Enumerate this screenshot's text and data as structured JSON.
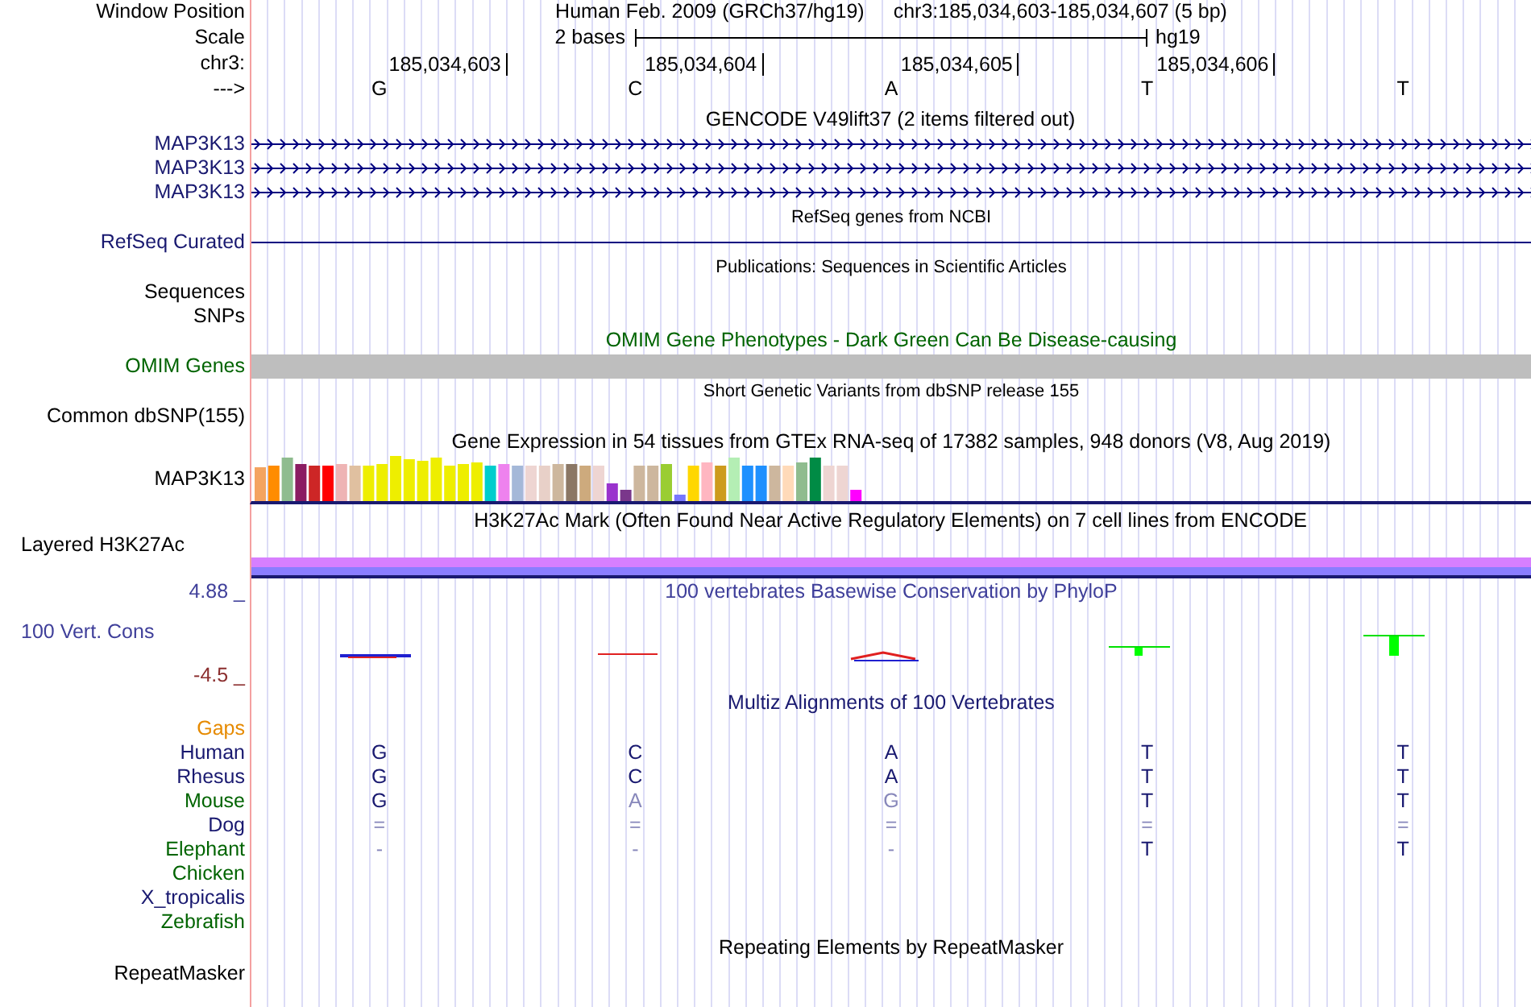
{
  "header": {
    "window_position_label": "Window Position",
    "assembly": "Human Feb. 2009 (GRCh37/hg19)",
    "position": "chr3:185,034,603-185,034,607 (5 bp)",
    "scale_label": "Scale",
    "scale_text": "2 bases",
    "scale_db": "hg19",
    "chrom_label": "chr3:",
    "ticks": [
      "185,034,603",
      "185,034,604",
      "185,034,605",
      "185,034,606"
    ],
    "strand_label": "--->",
    "bases": [
      "G",
      "C",
      "A",
      "T",
      "T"
    ]
  },
  "tracks": [
    {
      "kind": "gene",
      "title": "GENCODE V49lift37 (2 items filtered out)",
      "small_title": false,
      "color": "#191970",
      "items": [
        {
          "label": "MAP3K13",
          "strand_arrows": true
        },
        {
          "label": "MAP3K13",
          "strand_arrows": true
        },
        {
          "label": "MAP3K13",
          "strand_arrows": true
        }
      ]
    },
    {
      "kind": "gene",
      "title": "RefSeq genes from NCBI",
      "small_title": true,
      "color": "#191970",
      "items": [
        {
          "label": "RefSeq Curated",
          "strand_arrows": false
        }
      ]
    },
    {
      "kind": "labels",
      "title": "Publications: Sequences in Scientific Articles",
      "small_title": true,
      "color": "#000000",
      "labels": [
        "Sequences",
        "SNPs"
      ]
    },
    {
      "kind": "bar",
      "title": "OMIM Gene Phenotypes - Dark Green Can Be Disease-causing",
      "small_title": false,
      "color": "#006400",
      "labels": [
        "OMIM Genes"
      ]
    },
    {
      "kind": "labels",
      "title": "Short Genetic Variants from dbSNP release 155",
      "small_title": true,
      "color": "#000000",
      "labels": [
        "Common dbSNP(155)"
      ]
    },
    {
      "kind": "expression",
      "title": "Gene Expression in 54 tissues from GTEx RNA-seq of 17382 samples, 948 donors (V8, Aug 2019)",
      "small_title": false,
      "color": "#000000",
      "labels": [
        "MAP3K13"
      ]
    },
    {
      "kind": "layered",
      "title": "H3K27Ac Mark (Often Found Near Active Regulatory Elements) on 7 cell lines from ENCODE",
      "small_title": false,
      "color": "#000000",
      "labels": [
        "Layered H3K27Ac"
      ]
    },
    {
      "kind": "wiggle",
      "title": "100 vertebrates Basewise Conservation by PhyloP",
      "small_title": false,
      "color": "#3f3f9a",
      "labels": [
        "100 Vert. Cons"
      ],
      "max_label": "4.88 _",
      "min_label": "-4.5 _"
    },
    {
      "kind": "alignment",
      "title": "Multiz Alignments of 100 Vertebrates",
      "small_title": false,
      "color": "#191970",
      "species": [
        {
          "name": "Gaps",
          "color": "#e68a00"
        },
        {
          "name": "Human",
          "color": "#191970",
          "bases": [
            {
              "text": "G",
              "dim": false
            },
            {
              "text": "C",
              "dim": false
            },
            {
              "text": "A",
              "dim": false
            },
            {
              "text": "T",
              "dim": false
            },
            {
              "text": "T",
              "dim": false
            }
          ]
        },
        {
          "name": "Rhesus",
          "color": "#191970",
          "bases": [
            {
              "text": "G",
              "dim": false
            },
            {
              "text": "C",
              "dim": false
            },
            {
              "text": "A",
              "dim": false
            },
            {
              "text": "T",
              "dim": false
            },
            {
              "text": "T",
              "dim": false
            }
          ]
        },
        {
          "name": "Mouse",
          "color": "#006400",
          "bases": [
            {
              "text": "G",
              "dim": false
            },
            {
              "text": "A",
              "dim": true
            },
            {
              "text": "G",
              "dim": true
            },
            {
              "text": "T",
              "dim": false
            },
            {
              "text": "T",
              "dim": false
            }
          ]
        },
        {
          "name": "Dog",
          "color": "#191970",
          "bases": [
            {
              "text": "=",
              "dim": true
            },
            {
              "text": "=",
              "dim": true
            },
            {
              "text": "=",
              "dim": true
            },
            {
              "text": "=",
              "dim": true
            },
            {
              "text": "=",
              "dim": true
            }
          ]
        },
        {
          "name": "Elephant",
          "color": "#006400",
          "bases": [
            {
              "text": "-",
              "dim": true
            },
            {
              "text": "-",
              "dim": true
            },
            {
              "text": "-",
              "dim": true
            },
            {
              "text": "T",
              "dim": false
            },
            {
              "text": "T",
              "dim": false
            }
          ]
        },
        {
          "name": "Chicken",
          "color": "#006400"
        },
        {
          "name": "X_tropicalis",
          "color": "#191970"
        },
        {
          "name": "Zebrafish",
          "color": "#006400"
        }
      ]
    },
    {
      "kind": "labels",
      "title": "Repeating Elements by RepeatMasker",
      "small_title": false,
      "color": "#000000",
      "labels": [
        "RepeatMasker"
      ]
    }
  ]
}
